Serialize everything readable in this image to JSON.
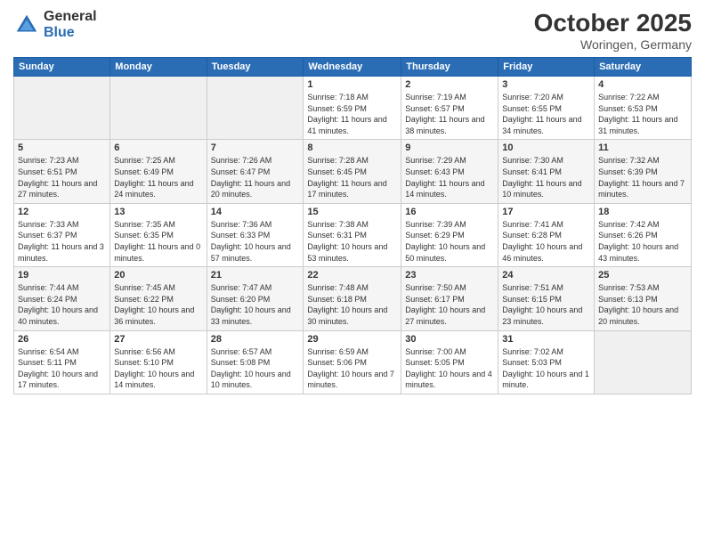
{
  "header": {
    "logo_general": "General",
    "logo_blue": "Blue",
    "month": "October 2025",
    "location": "Woringen, Germany"
  },
  "weekdays": [
    "Sunday",
    "Monday",
    "Tuesday",
    "Wednesday",
    "Thursday",
    "Friday",
    "Saturday"
  ],
  "weeks": [
    [
      {
        "day": "",
        "empty": true
      },
      {
        "day": "",
        "empty": true
      },
      {
        "day": "",
        "empty": true
      },
      {
        "day": "1",
        "sunrise": "7:18 AM",
        "sunset": "6:59 PM",
        "daylight": "11 hours and 41 minutes."
      },
      {
        "day": "2",
        "sunrise": "7:19 AM",
        "sunset": "6:57 PM",
        "daylight": "11 hours and 38 minutes."
      },
      {
        "day": "3",
        "sunrise": "7:20 AM",
        "sunset": "6:55 PM",
        "daylight": "11 hours and 34 minutes."
      },
      {
        "day": "4",
        "sunrise": "7:22 AM",
        "sunset": "6:53 PM",
        "daylight": "11 hours and 31 minutes."
      }
    ],
    [
      {
        "day": "5",
        "sunrise": "7:23 AM",
        "sunset": "6:51 PM",
        "daylight": "11 hours and 27 minutes."
      },
      {
        "day": "6",
        "sunrise": "7:25 AM",
        "sunset": "6:49 PM",
        "daylight": "11 hours and 24 minutes."
      },
      {
        "day": "7",
        "sunrise": "7:26 AM",
        "sunset": "6:47 PM",
        "daylight": "11 hours and 20 minutes."
      },
      {
        "day": "8",
        "sunrise": "7:28 AM",
        "sunset": "6:45 PM",
        "daylight": "11 hours and 17 minutes."
      },
      {
        "day": "9",
        "sunrise": "7:29 AM",
        "sunset": "6:43 PM",
        "daylight": "11 hours and 14 minutes."
      },
      {
        "day": "10",
        "sunrise": "7:30 AM",
        "sunset": "6:41 PM",
        "daylight": "11 hours and 10 minutes."
      },
      {
        "day": "11",
        "sunrise": "7:32 AM",
        "sunset": "6:39 PM",
        "daylight": "11 hours and 7 minutes."
      }
    ],
    [
      {
        "day": "12",
        "sunrise": "7:33 AM",
        "sunset": "6:37 PM",
        "daylight": "11 hours and 3 minutes."
      },
      {
        "day": "13",
        "sunrise": "7:35 AM",
        "sunset": "6:35 PM",
        "daylight": "11 hours and 0 minutes."
      },
      {
        "day": "14",
        "sunrise": "7:36 AM",
        "sunset": "6:33 PM",
        "daylight": "10 hours and 57 minutes."
      },
      {
        "day": "15",
        "sunrise": "7:38 AM",
        "sunset": "6:31 PM",
        "daylight": "10 hours and 53 minutes."
      },
      {
        "day": "16",
        "sunrise": "7:39 AM",
        "sunset": "6:29 PM",
        "daylight": "10 hours and 50 minutes."
      },
      {
        "day": "17",
        "sunrise": "7:41 AM",
        "sunset": "6:28 PM",
        "daylight": "10 hours and 46 minutes."
      },
      {
        "day": "18",
        "sunrise": "7:42 AM",
        "sunset": "6:26 PM",
        "daylight": "10 hours and 43 minutes."
      }
    ],
    [
      {
        "day": "19",
        "sunrise": "7:44 AM",
        "sunset": "6:24 PM",
        "daylight": "10 hours and 40 minutes."
      },
      {
        "day": "20",
        "sunrise": "7:45 AM",
        "sunset": "6:22 PM",
        "daylight": "10 hours and 36 minutes."
      },
      {
        "day": "21",
        "sunrise": "7:47 AM",
        "sunset": "6:20 PM",
        "daylight": "10 hours and 33 minutes."
      },
      {
        "day": "22",
        "sunrise": "7:48 AM",
        "sunset": "6:18 PM",
        "daylight": "10 hours and 30 minutes."
      },
      {
        "day": "23",
        "sunrise": "7:50 AM",
        "sunset": "6:17 PM",
        "daylight": "10 hours and 27 minutes."
      },
      {
        "day": "24",
        "sunrise": "7:51 AM",
        "sunset": "6:15 PM",
        "daylight": "10 hours and 23 minutes."
      },
      {
        "day": "25",
        "sunrise": "7:53 AM",
        "sunset": "6:13 PM",
        "daylight": "10 hours and 20 minutes."
      }
    ],
    [
      {
        "day": "26",
        "sunrise": "6:54 AM",
        "sunset": "5:11 PM",
        "daylight": "10 hours and 17 minutes."
      },
      {
        "day": "27",
        "sunrise": "6:56 AM",
        "sunset": "5:10 PM",
        "daylight": "10 hours and 14 minutes."
      },
      {
        "day": "28",
        "sunrise": "6:57 AM",
        "sunset": "5:08 PM",
        "daylight": "10 hours and 10 minutes."
      },
      {
        "day": "29",
        "sunrise": "6:59 AM",
        "sunset": "5:06 PM",
        "daylight": "10 hours and 7 minutes."
      },
      {
        "day": "30",
        "sunrise": "7:00 AM",
        "sunset": "5:05 PM",
        "daylight": "10 hours and 4 minutes."
      },
      {
        "day": "31",
        "sunrise": "7:02 AM",
        "sunset": "5:03 PM",
        "daylight": "10 hours and 1 minute."
      },
      {
        "day": "",
        "empty": true
      }
    ]
  ]
}
